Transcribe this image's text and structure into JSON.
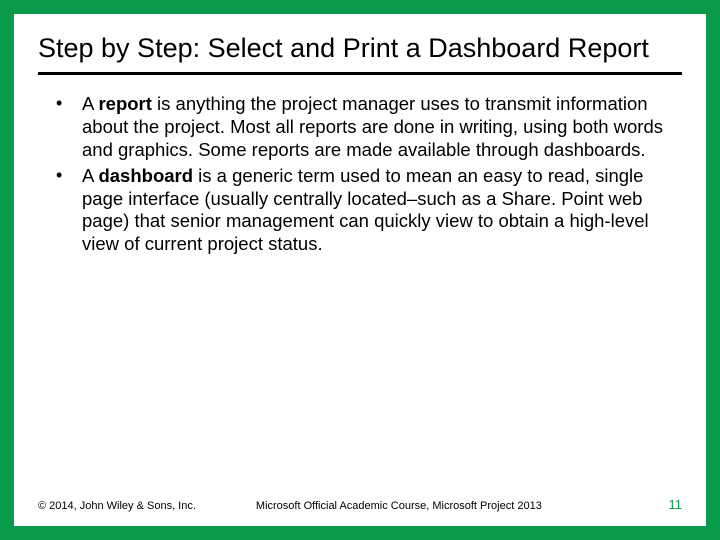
{
  "title": "Step by Step: Select and Print a Dashboard Report",
  "bullets": [
    {
      "prefix": "A ",
      "bold": "report",
      "rest": " is anything the project manager uses to transmit information about the project. Most all reports are done in writing, using both words and graphics. Some reports are made available through dashboards."
    },
    {
      "prefix": "A ",
      "bold": "dashboard",
      "rest": " is a generic term used to mean an easy to read, single page interface (usually centrally located–such as a Share. Point web page) that senior management can quickly view to obtain a high-level view of current project status."
    }
  ],
  "footer": {
    "copyright": "© 2014, John Wiley & Sons, Inc.",
    "course": "Microsoft Official Academic Course, Microsoft Project 2013",
    "page": "11"
  }
}
